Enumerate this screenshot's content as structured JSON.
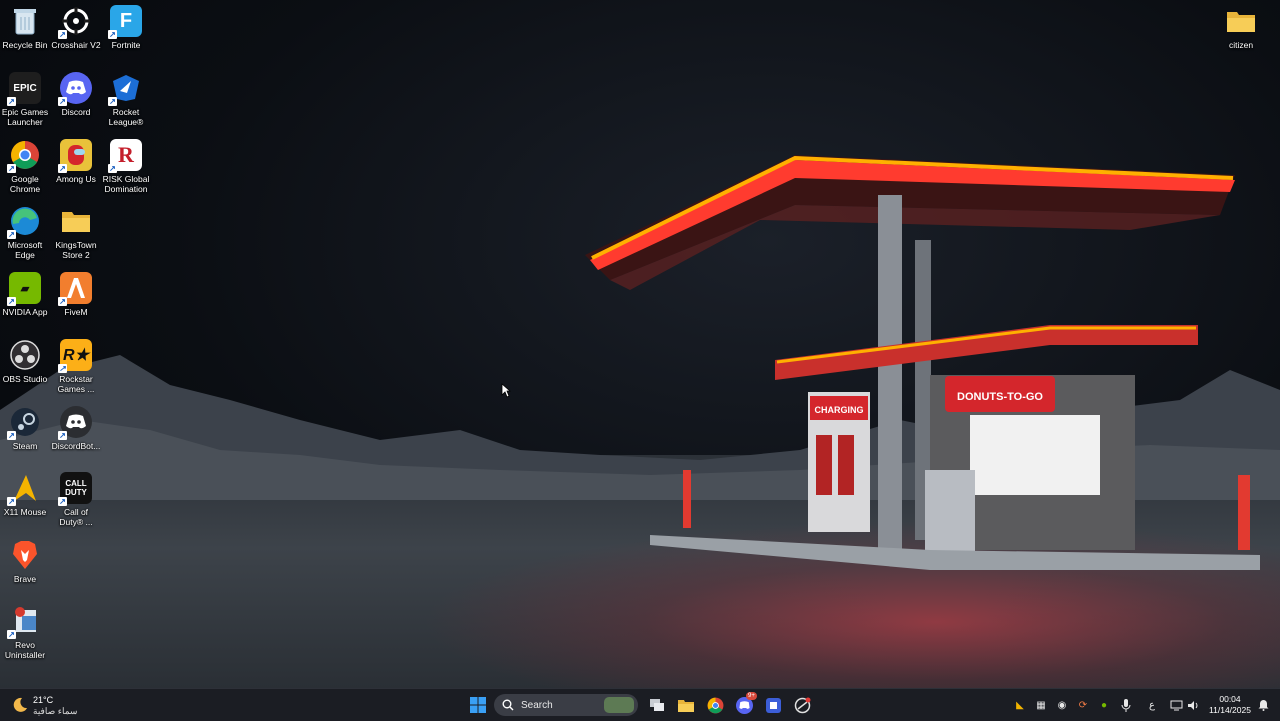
{
  "desktop": {
    "icons": [
      {
        "label": "Recycle Bin"
      },
      {
        "label": "Crosshair V2"
      },
      {
        "label": "Fortnite"
      },
      {
        "label": "Epic Games Launcher"
      },
      {
        "label": "Discord"
      },
      {
        "label": "Rocket League®"
      },
      {
        "label": "Google Chrome"
      },
      {
        "label": "Among Us"
      },
      {
        "label": "RISK Global Domination"
      },
      {
        "label": "Microsoft Edge"
      },
      {
        "label": "KingsTown Store 2"
      },
      {
        "label": "NVIDIA App"
      },
      {
        "label": "FiveM"
      },
      {
        "label": "OBS Studio"
      },
      {
        "label": "Rockstar Games ..."
      },
      {
        "label": "Steam"
      },
      {
        "label": "DiscordBot..."
      },
      {
        "label": "X11 Mouse"
      },
      {
        "label": "Call of Duty® ..."
      },
      {
        "label": "Brave"
      },
      {
        "label": "Revo Uninstaller"
      },
      {
        "label": "citizen"
      }
    ]
  },
  "wallpaper": {
    "sign_charging": "CHARGING",
    "sign_donuts": "DONUTS-TO-GO",
    "canopy_color": "#ff3b2f",
    "neon_color": "#ffb000"
  },
  "taskbar": {
    "weather": {
      "temp": "21°C",
      "desc": "سماء صافية"
    },
    "search_placeholder": "Search",
    "tray": {
      "lang": "ع",
      "time": "00:04",
      "date": "11/14/2025"
    },
    "discord_badge": "9+"
  },
  "colors": {
    "taskbar_bg": "#1c1e24",
    "accent": "#3b82f6"
  }
}
